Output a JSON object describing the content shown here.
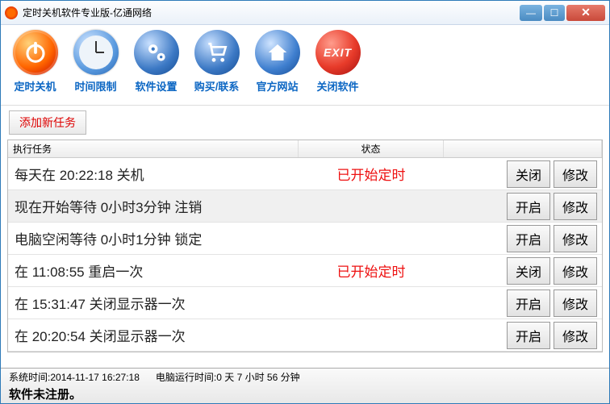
{
  "titlebar": {
    "title": "定时关机软件专业版-亿通网络"
  },
  "toolbar": {
    "items": [
      {
        "label": "定时关机"
      },
      {
        "label": "时间限制"
      },
      {
        "label": "软件设置"
      },
      {
        "label": "购买/联系"
      },
      {
        "label": "官方网站"
      },
      {
        "label": "关闭软件"
      }
    ],
    "exit_text": "EXIT"
  },
  "addbar": {
    "add_label": "添加新任务"
  },
  "table": {
    "headers": {
      "task": "执行任务",
      "status": "状态"
    },
    "rows": [
      {
        "task": "每天在 20:22:18 关机",
        "status": "已开始定时",
        "toggle": "关闭",
        "edit": "修改"
      },
      {
        "task": "现在开始等待 0小时3分钟 注销",
        "status": "",
        "toggle": "开启",
        "edit": "修改"
      },
      {
        "task": "电脑空闲等待 0小时1分钟 锁定",
        "status": "",
        "toggle": "开启",
        "edit": "修改"
      },
      {
        "task": "在 11:08:55 重启一次",
        "status": "已开始定时",
        "toggle": "关闭",
        "edit": "修改"
      },
      {
        "task": "在 15:31:47 关闭显示器一次",
        "status": "",
        "toggle": "开启",
        "edit": "修改"
      },
      {
        "task": "在 20:20:54 关闭显示器一次",
        "status": "",
        "toggle": "开启",
        "edit": "修改"
      }
    ]
  },
  "statusbar": {
    "system_time_label": "系统时间:",
    "system_time": "2014-11-17 16:27:18",
    "uptime_label": "电脑运行时间:",
    "uptime": "0 天 7 小时 56 分钟",
    "register": "软件未注册。"
  }
}
